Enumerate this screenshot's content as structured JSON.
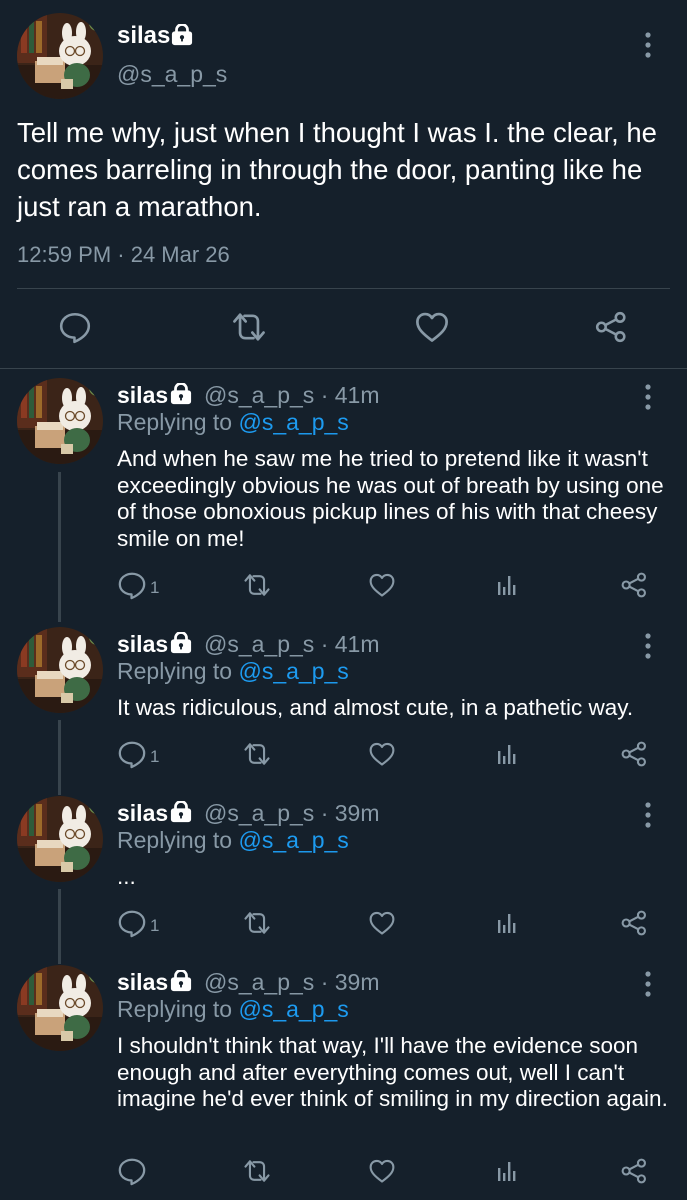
{
  "main_tweet": {
    "author_name": "silas",
    "handle": "@s_a_p_s",
    "text": "Tell me why, just when I thought I was I. the clear, he comes barreling in through the door, panting like he just ran a marathon.",
    "timestamp": "12:59 PM · 24 Mar 26"
  },
  "replies": [
    {
      "author_name": "silas",
      "handle_time": "@s_a_p_s · 41m",
      "replying_prefix": "Replying to ",
      "replying_handle": "@s_a_p_s",
      "text": "And when he saw me he tried to pretend like it wasn't exceedingly obvious he was out of breath by using one of those obnoxious pickup lines of his with that cheesy smile on me!",
      "reply_count": "1"
    },
    {
      "author_name": "silas",
      "handle_time": "@s_a_p_s · 41m",
      "replying_prefix": "Replying to ",
      "replying_handle": "@s_a_p_s",
      "text": "It was ridiculous, and almost cute, in a pathetic way.",
      "reply_count": "1"
    },
    {
      "author_name": "silas",
      "handle_time": "@s_a_p_s · 39m",
      "replying_prefix": "Replying to ",
      "replying_handle": "@s_a_p_s",
      "text": "...",
      "reply_count": "1"
    },
    {
      "author_name": "silas",
      "handle_time": "@s_a_p_s · 39m",
      "replying_prefix": "Replying to ",
      "replying_handle": "@s_a_p_s",
      "text": "I shouldn't think that way, I'll have the evidence soon enough and after everything comes out, well I can't imagine he'd ever think of smiling in my direction again.",
      "reply_count": ""
    }
  ],
  "icons": {
    "lock": "lock-icon",
    "menu": "more-vertical-icon",
    "reply": "comment-icon",
    "retweet": "retweet-icon",
    "like": "heart-icon",
    "analytics": "analytics-icon",
    "share": "share-icon"
  },
  "colors": {
    "background": "#15202b",
    "muted": "#8899a6",
    "link": "#1d9bf0",
    "divider": "#38444d"
  }
}
